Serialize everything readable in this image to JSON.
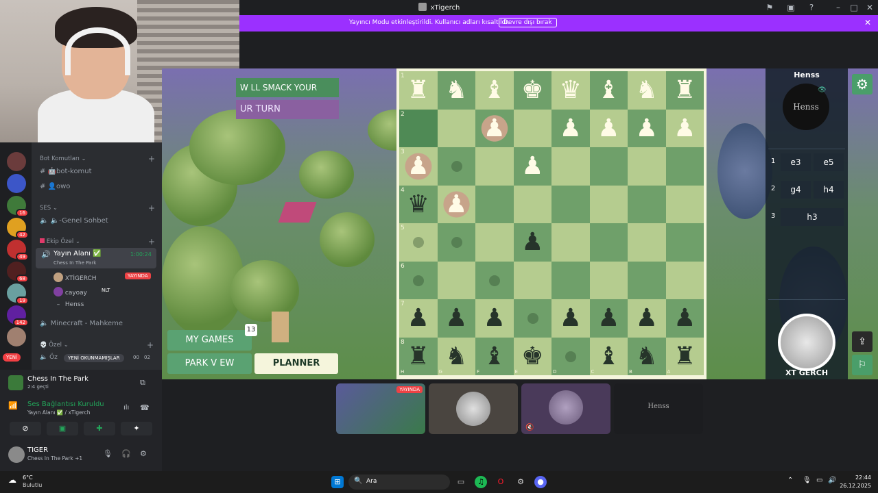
{
  "window": {
    "title": "xTigerch"
  },
  "banner": {
    "message": "Yayıncı Modu etkinleştirildi. Kullanıcı adları kısaltıldı.",
    "button": "Devre dışı bırak"
  },
  "servers": [
    {
      "badge": ""
    },
    {
      "badge": ""
    },
    {
      "badge": "16"
    },
    {
      "badge": "42"
    },
    {
      "badge": "49"
    },
    {
      "badge": "68"
    },
    {
      "badge": "19"
    },
    {
      "badge": "142"
    },
    {
      "badge": ""
    }
  ],
  "rail": {
    "new_label": "YENİ"
  },
  "channels": {
    "cat_bot": "Bot Komutları",
    "bot_komut": "🤖bot-komut",
    "owo": "👤owo",
    "cat_ses": "SES",
    "genel_sohbet": "🔈-Genel Sohbet",
    "cat_ekip": "Ekip Özel",
    "yayin_alani": "Yayın Alanı ✅",
    "yayin_activity": "Chess In The Park",
    "yayin_timer": "1:00:24",
    "members": [
      {
        "name": "XTİGERCH",
        "tag": "YAYINDA"
      },
      {
        "name": "cayoay",
        "tag": "NLT"
      },
      {
        "name": "Henss",
        "tag": ""
      }
    ],
    "minecraft": "Minecraft - Mahkeme",
    "cat_ozel": "Özel",
    "ozel_partial": "Öz",
    "unread_pill": "YENİ OKUNMAMIŞLAR",
    "unread_counts": [
      "00",
      "02"
    ]
  },
  "activity": {
    "title": "Chess In The Park",
    "subtitle": "2:4 geçti"
  },
  "voice": {
    "status": "Ses Bağlantısı Kuruldu",
    "channel": "Yayın Alanı ✅ / xTigerch"
  },
  "user": {
    "name": "TIGER",
    "status": "Chess In The Park +1"
  },
  "game": {
    "ribbon1": "W LL SMACK YOUR RULE",
    "ribbon2": "UR TURN",
    "my_games": "MY GAMES",
    "my_games_count": "13",
    "park_view": "PARK V EW",
    "planner": "PLANNER",
    "opponent": "Henss",
    "opponent_avatar_text": "Henss",
    "player": "XT GERCH",
    "moves": [
      {
        "n": "1",
        "w": "e3",
        "b": "e5"
      },
      {
        "n": "2",
        "w": "g4",
        "b": "h4"
      },
      {
        "n": "3",
        "w": "h3",
        "b": ""
      }
    ],
    "ranks": [
      "1",
      "2",
      "3",
      "4",
      "5",
      "6",
      "7",
      "8"
    ],
    "files": [
      "H",
      "G",
      "F",
      "E",
      "D",
      "C",
      "B",
      "A"
    ],
    "board": [
      [
        "♜",
        "♞",
        "♝",
        "♚",
        "♛",
        "♝",
        "♞",
        "♜"
      ],
      [
        "",
        "",
        "♟",
        "",
        "♟",
        "♟",
        "♟",
        "♟"
      ],
      [
        "♟",
        "",
        "",
        "♟",
        "",
        "",
        "",
        ""
      ],
      [
        "♛",
        "♟",
        "",
        "",
        "",
        "",
        "",
        ""
      ],
      [
        "",
        "",
        "",
        "♟",
        "",
        "",
        "",
        ""
      ],
      [
        "",
        "",
        "",
        "",
        "",
        "",
        "",
        ""
      ],
      [
        "♟",
        "♟",
        "♟",
        "",
        "♟",
        "♟",
        "♟",
        "♟"
      ],
      [
        "♜",
        "♞",
        "♝",
        "♚",
        "",
        "♝",
        "♞",
        "♜"
      ]
    ]
  },
  "thumbs": {
    "live": "YAYINDA",
    "henss": "Henss"
  },
  "taskbar": {
    "weather_temp": "6°C",
    "weather_desc": "Bulutlu",
    "search": "Ara",
    "time": "22:44",
    "date": "26.12.2025"
  }
}
